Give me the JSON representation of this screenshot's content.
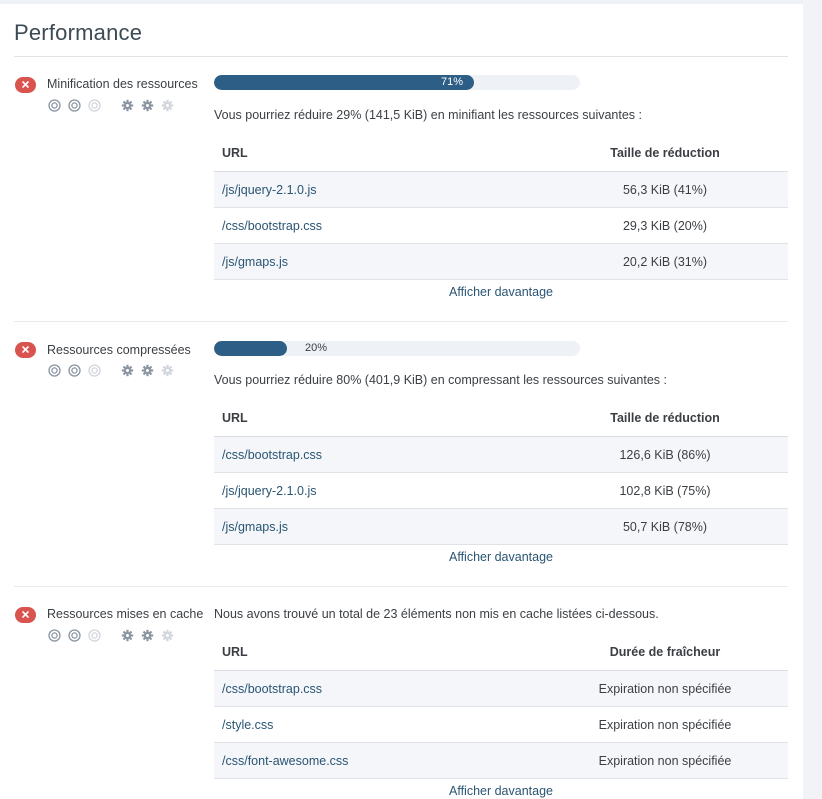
{
  "page": {
    "title": "Performance"
  },
  "colors": {
    "accent": "#2d5f86",
    "error": "#d9534f",
    "link": "#2a5573"
  },
  "sections": [
    {
      "name": "Minification des ressources",
      "status_icon": "error-x-icon",
      "progress_percent": 71,
      "progress_label": "71%",
      "description": "Vous pourriez réduire 29% (141,5 KiB) en minifiant les ressources suivantes :",
      "columns": [
        "URL",
        "Taille de réduction"
      ],
      "rows": [
        {
          "url": "/js/jquery-2.1.0.js",
          "value": "56,3 KiB (41%)"
        },
        {
          "url": "/css/bootstrap.css",
          "value": "29,3 KiB (20%)"
        },
        {
          "url": "/js/gmaps.js",
          "value": "20,2 KiB (31%)"
        }
      ],
      "more_label": "Afficher davantage"
    },
    {
      "name": "Ressources compressées",
      "status_icon": "error-x-icon",
      "progress_percent": 20,
      "progress_label": "20%",
      "description": "Vous pourriez réduire 80% (401,9 KiB) en compressant les ressources suivantes :",
      "columns": [
        "URL",
        "Taille de réduction"
      ],
      "rows": [
        {
          "url": "/css/bootstrap.css",
          "value": "126,6 KiB (86%)"
        },
        {
          "url": "/js/jquery-2.1.0.js",
          "value": "102,8 KiB (75%)"
        },
        {
          "url": "/js/gmaps.js",
          "value": "50,7 KiB (78%)"
        }
      ],
      "more_label": "Afficher davantage"
    },
    {
      "name": "Ressources mises en cache",
      "status_icon": "error-x-icon",
      "description": "Nous avons trouvé un total de 23 éléments non mis en cache listées ci-dessous.",
      "columns": [
        "URL",
        "Durée de fraîcheur"
      ],
      "rows": [
        {
          "url": "/css/bootstrap.css",
          "value": "Expiration non spécifiée"
        },
        {
          "url": "/style.css",
          "value": "Expiration non spécifiée"
        },
        {
          "url": "/css/font-awesome.css",
          "value": "Expiration non spécifiée"
        }
      ],
      "more_label": "Afficher davantage"
    }
  ]
}
